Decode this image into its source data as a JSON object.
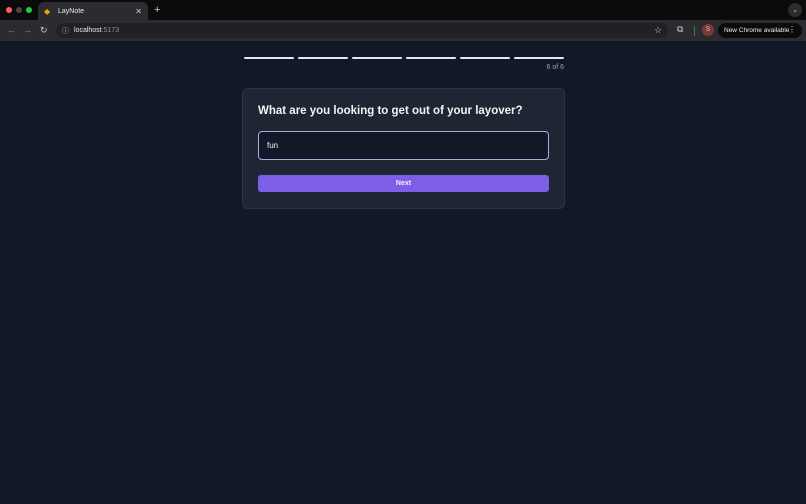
{
  "browser": {
    "tab": {
      "title": "LayNote",
      "favicon": "diamond-favicon"
    },
    "new_tab_label": "+",
    "address": {
      "host": "localhost",
      "port": ":5173"
    },
    "update_label": "New Chrome available",
    "profile_initial": "S"
  },
  "onboarding": {
    "steps_total": 6,
    "steps_completed": 6,
    "step_counter": "6 of 6",
    "question": "What are you looking to get out of your layover?",
    "answer_value": "fun",
    "next_label": "Next"
  },
  "colors": {
    "page_bg": "#121827",
    "card_bg": "#1f2533",
    "accent": "#7c5fe6",
    "input_focus_border": "#9db3e0"
  }
}
